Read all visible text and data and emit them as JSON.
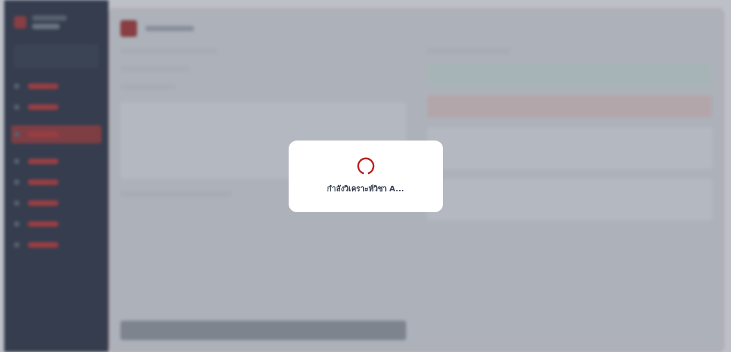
{
  "loading_dialog": {
    "message": "กำลังวิเคราะห์วิชา A..."
  }
}
